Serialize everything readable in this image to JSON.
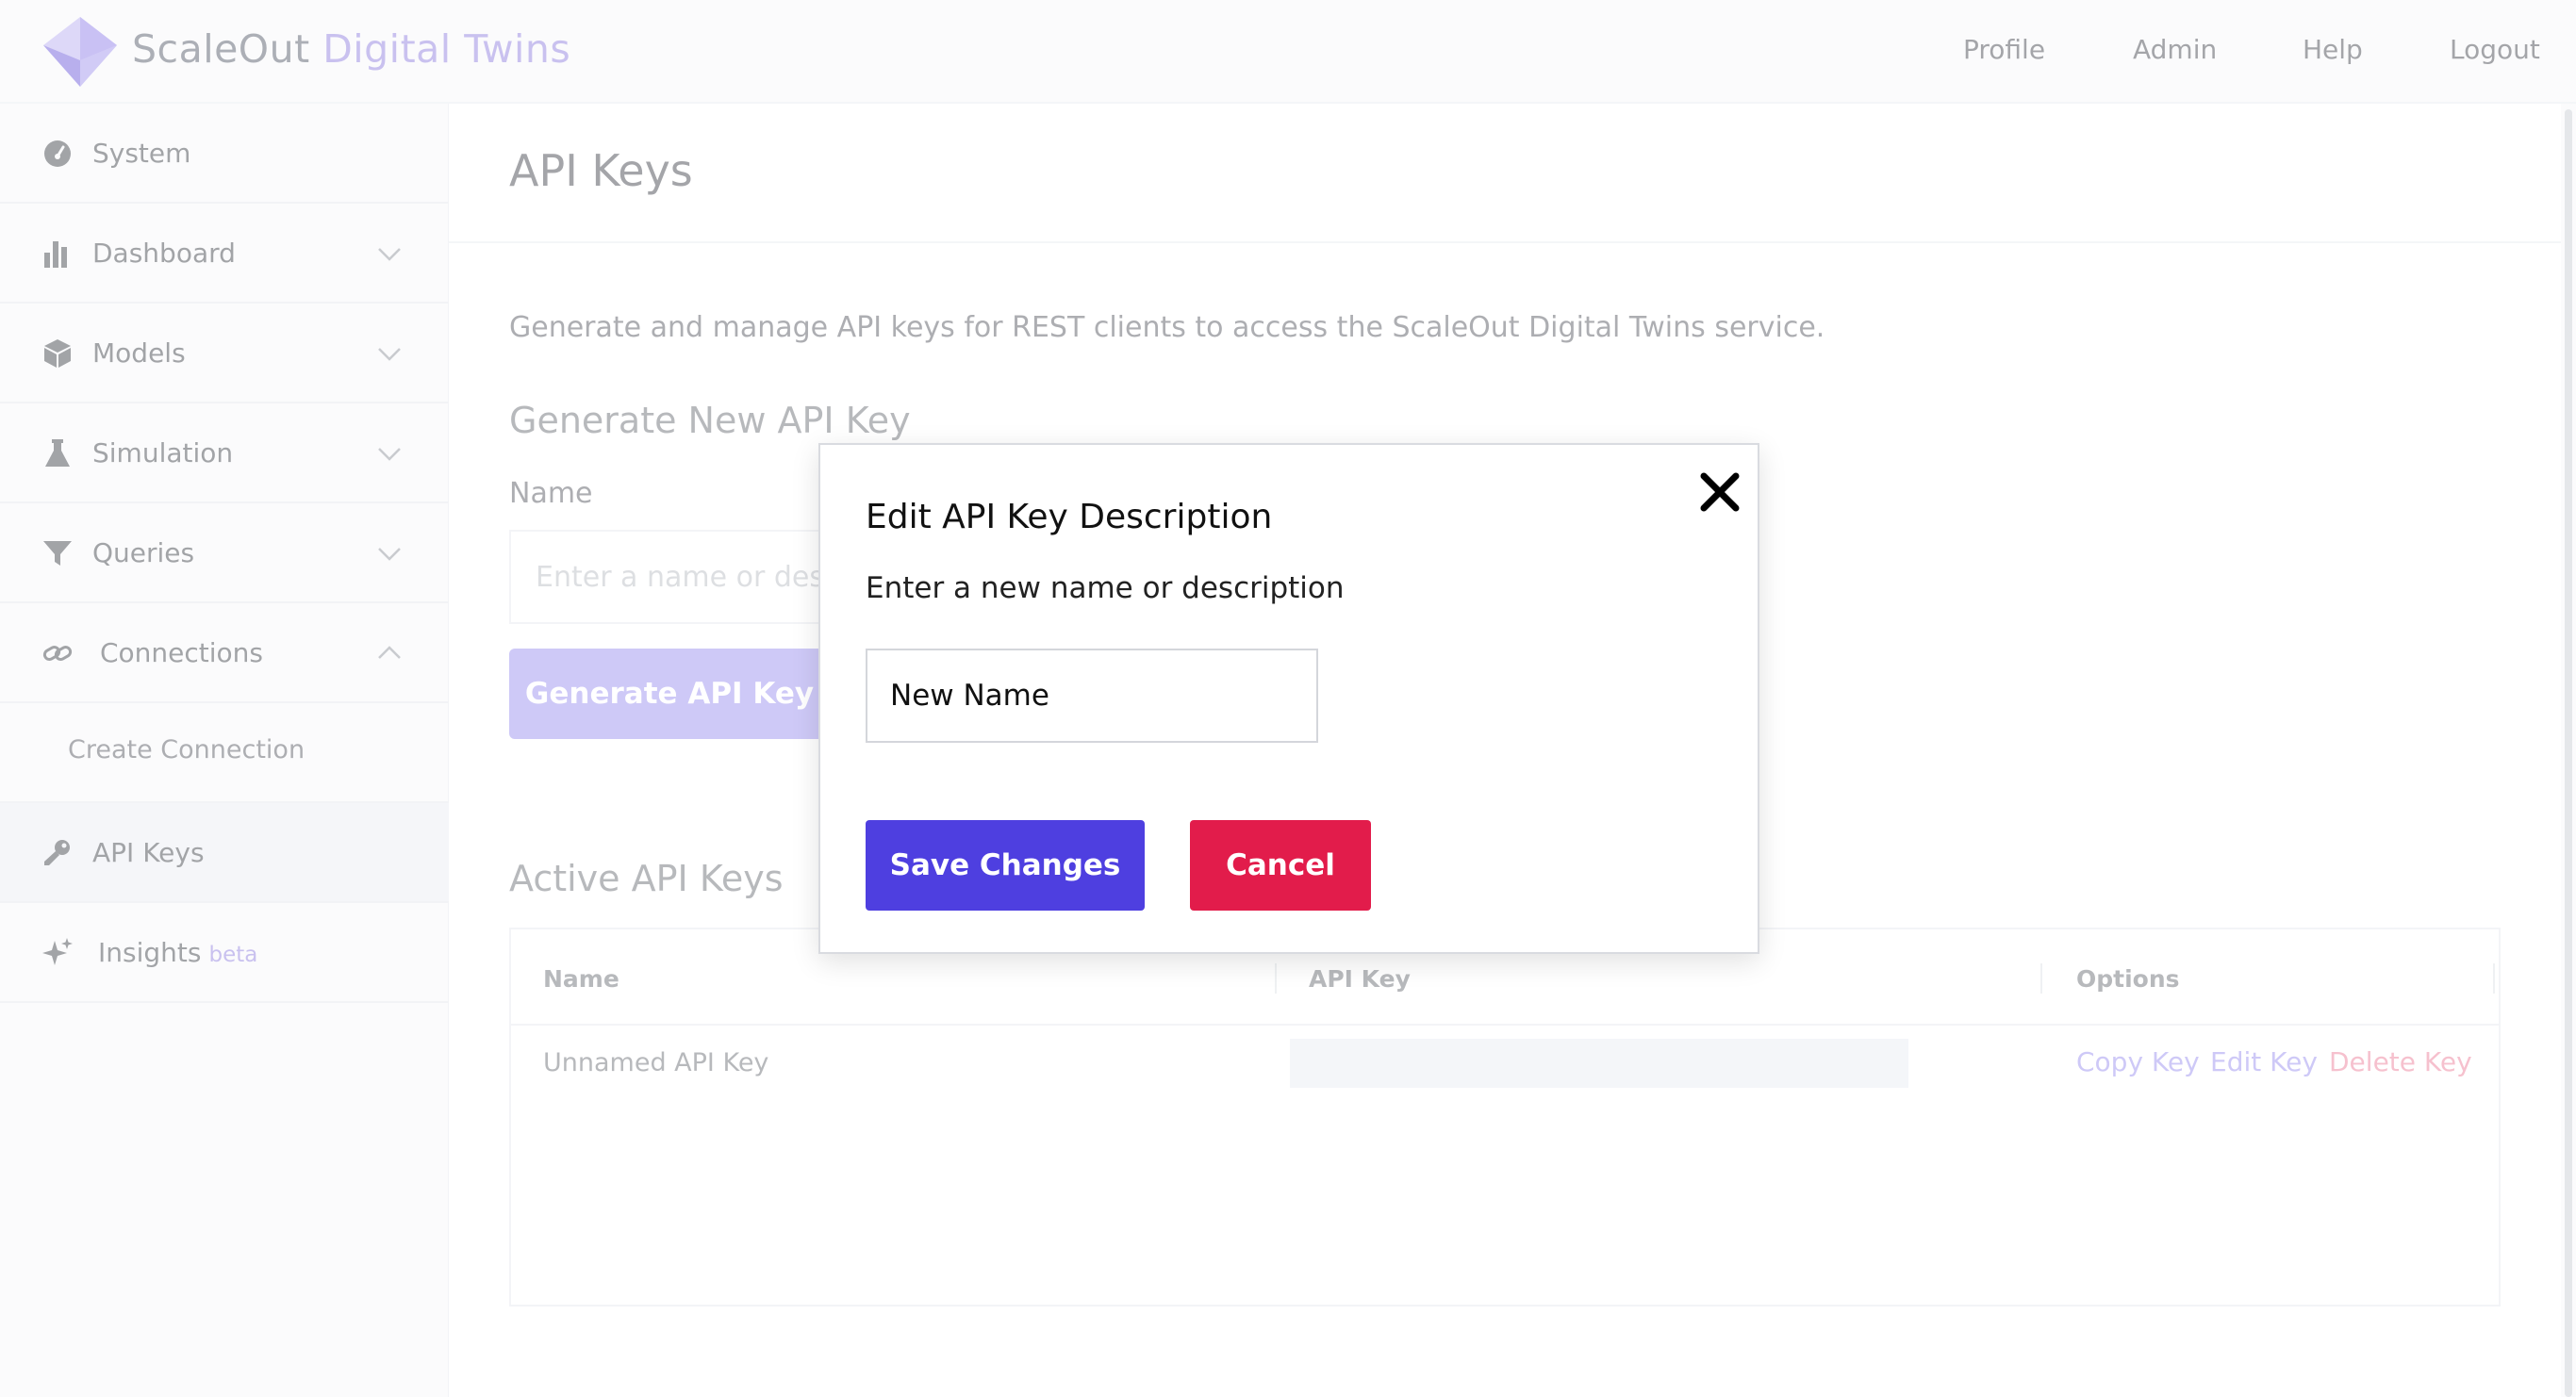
{
  "brand": {
    "name_part1": "ScaleOut",
    "name_part2": "Digital Twins"
  },
  "topnav": [
    "Profile",
    "Admin",
    "Help",
    "Logout"
  ],
  "sidebar": {
    "items": [
      {
        "label": "System",
        "icon": "gauge-icon"
      },
      {
        "label": "Dashboard",
        "icon": "bar-chart-icon",
        "expanded": false
      },
      {
        "label": "Models",
        "icon": "cube-icon",
        "expanded": false
      },
      {
        "label": "Simulation",
        "icon": "flask-icon",
        "expanded": false
      },
      {
        "label": "Queries",
        "icon": "filter-icon",
        "expanded": false
      },
      {
        "label": "Connections",
        "icon": "link-icon",
        "expanded": true
      },
      {
        "label": "Create Connection",
        "sub": true
      },
      {
        "label": "API Keys",
        "icon": "key-icon",
        "active": true
      },
      {
        "label": "Insights",
        "icon": "sparkle-icon",
        "badge": "beta"
      }
    ]
  },
  "page": {
    "title": "API Keys",
    "description": "Generate and manage API keys for REST clients to access the ScaleOut Digital Twins service.",
    "generate_heading": "Generate New API Key",
    "name_label": "Name",
    "name_placeholder": "Enter a name or description",
    "generate_button": "Generate API Key",
    "active_heading": "Active API Keys"
  },
  "table": {
    "columns": [
      "Name",
      "API Key",
      "Options"
    ],
    "rows": [
      {
        "name": "Unnamed API Key",
        "options": [
          "Copy Key",
          "Edit Key",
          "Delete Key"
        ]
      }
    ]
  },
  "modal": {
    "title": "Edit API Key Description",
    "subtitle": "Enter a new name or description",
    "input_value": "New Name",
    "save_label": "Save Changes",
    "cancel_label": "Cancel"
  },
  "colors": {
    "accent": "#4e3fe0",
    "accent_light": "#b1a8f3",
    "danger": "#e21c4b",
    "option_copy": "#b1a8f3",
    "option_delete": "#f19bb0"
  }
}
